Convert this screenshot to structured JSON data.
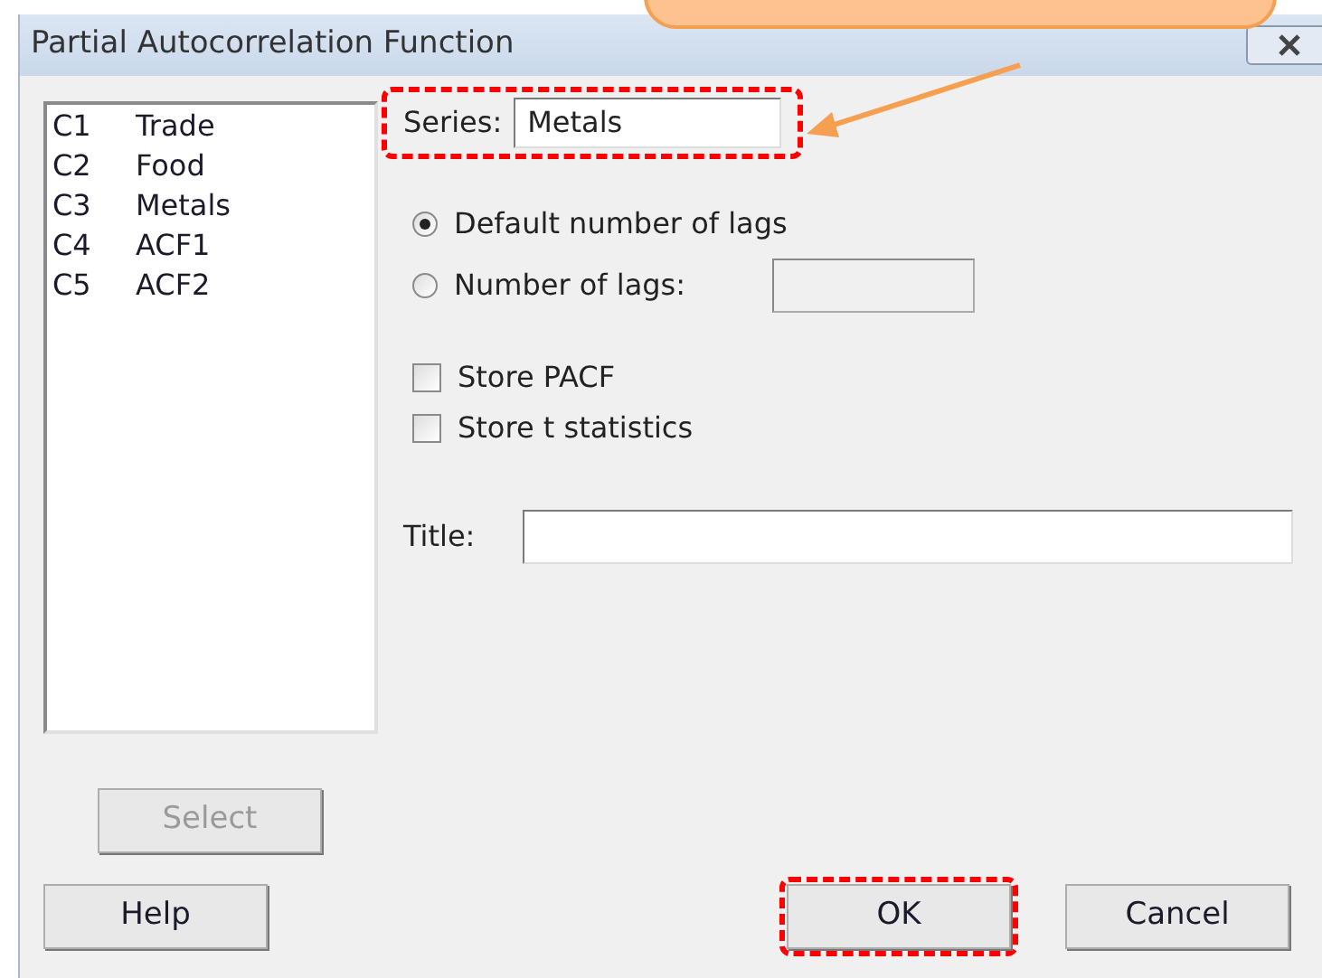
{
  "window": {
    "title": "Partial Autocorrelation Function"
  },
  "columns": [
    {
      "number": "C1",
      "name": "Trade"
    },
    {
      "number": "C2",
      "name": "Food"
    },
    {
      "number": "C3",
      "name": "Metals"
    },
    {
      "number": "C4",
      "name": "ACF1"
    },
    {
      "number": "C5",
      "name": "ACF2"
    }
  ],
  "series": {
    "label": "Series:",
    "value": "Metals",
    "highlighted": true
  },
  "lag_options": [
    {
      "label": "Default number of lags",
      "selected": true
    },
    {
      "label": "Number of lags:",
      "selected": false,
      "field": {
        "disabled": true
      }
    }
  ],
  "store_options": [
    {
      "label": "Store PACF",
      "checked": false
    },
    {
      "label": "Store t statistics",
      "checked": false
    }
  ],
  "title_field": {
    "label": "Title:"
  },
  "select_button": {
    "label": "Select",
    "disabled": true
  },
  "buttons": [
    {
      "label": "Help",
      "highlighted": false
    },
    {
      "label": "OK",
      "highlighted": true
    },
    {
      "label": "Cancel",
      "highlighted": false
    }
  ]
}
